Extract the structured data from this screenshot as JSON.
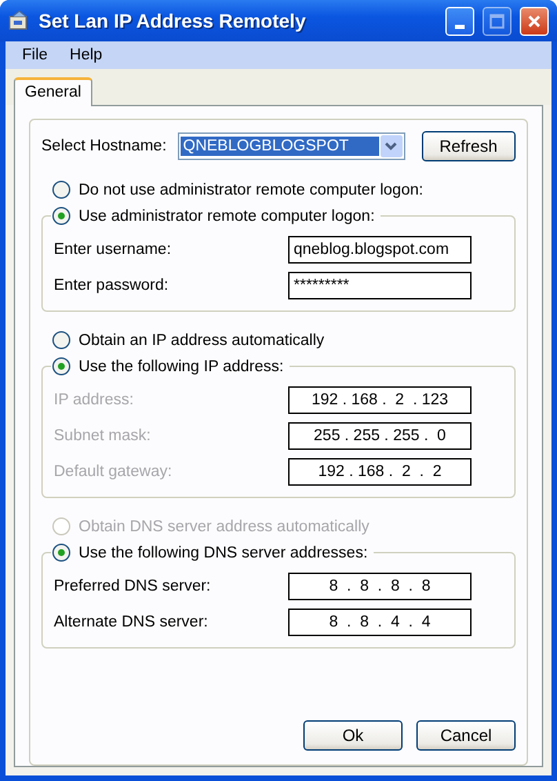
{
  "window": {
    "title": "Set Lan IP Address Remotely"
  },
  "menu": [
    {
      "label": "File"
    },
    {
      "label": "Help"
    }
  ],
  "tabs": [
    {
      "label": "General",
      "selected": true
    }
  ],
  "hostname": {
    "label": "Select Hostname:",
    "value": "QNEBLOGBLOGSPOT",
    "highlighted": true
  },
  "refresh_button": "Refresh",
  "sections": [
    {
      "option": {
        "label": "Do not use administrator remote computer logon:",
        "selected": false,
        "disabled": false
      },
      "group_option": {
        "label": "Use administrator remote computer logon:",
        "selected": true,
        "disabled": false
      },
      "fields": [
        {
          "kind": "text",
          "label": "Enter username:",
          "disabled": false,
          "value": "qneblog.blogspot.com"
        },
        {
          "kind": "password",
          "label": "Enter password:",
          "disabled": false,
          "value": "*********"
        }
      ]
    },
    {
      "option": {
        "label": "Obtain an IP address automatically",
        "selected": false,
        "disabled": false
      },
      "group_option": {
        "label": "Use the following IP address:",
        "selected": true,
        "disabled": false
      },
      "fields": [
        {
          "kind": "ip",
          "label": "IP address:",
          "disabled": true,
          "value": "192 . 168 .  2  . 123"
        },
        {
          "kind": "ip",
          "label": "Subnet mask:",
          "disabled": true,
          "value": "255 . 255 . 255 .  0"
        },
        {
          "kind": "ip",
          "label": "Default gateway:",
          "disabled": true,
          "value": "192 . 168 .  2  .  2"
        }
      ]
    },
    {
      "option": {
        "label": "Obtain DNS server address automatically",
        "selected": false,
        "disabled": true
      },
      "group_option": {
        "label": "Use the following DNS server addresses:",
        "selected": true,
        "disabled": false
      },
      "fields": [
        {
          "kind": "ip",
          "label": "Preferred DNS server:",
          "disabled": false,
          "value": "8  .  8  .  8  .  8"
        },
        {
          "kind": "ip",
          "label": "Alternate DNS server:",
          "disabled": false,
          "value": "8  .  8  .  4  .  4"
        }
      ]
    }
  ],
  "buttons": [
    "Ok",
    "Cancel"
  ]
}
